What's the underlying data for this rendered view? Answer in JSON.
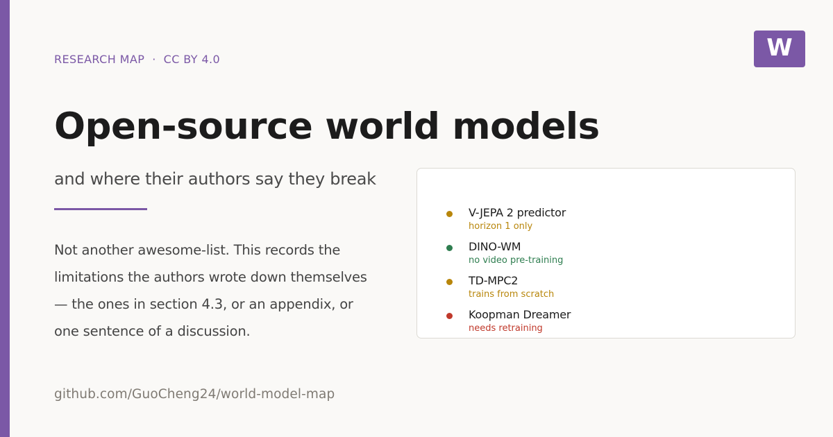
{
  "header": {
    "eyebrow": "RESEARCH MAP  ·  CC BY 4.0",
    "logo_letter": "W"
  },
  "hero": {
    "title": "Open-source world models",
    "subtitle": "and where their authors say they break",
    "description": "Not another awesome-list. This records the limitations the authors wrote down themselves — the ones in section 4.3, or an appendix, or one sentence of a discussion."
  },
  "footer": {
    "repo": "github.com/GuoCheng24/world-model-map"
  },
  "colors": {
    "brand": "#7b58a6",
    "warning": "#b8860b",
    "ok": "#2e7d4f",
    "error": "#c0392b"
  },
  "models": [
    {
      "name": "V-JEPA 2 predictor",
      "note": "horizon 1 only",
      "status": "warning",
      "color": "#b8860b"
    },
    {
      "name": "DINO-WM",
      "note": "no video pre-training",
      "status": "ok",
      "color": "#2e7d4f"
    },
    {
      "name": "TD-MPC2",
      "note": "trains from scratch",
      "status": "warning",
      "color": "#b8860b"
    },
    {
      "name": "Koopman Dreamer",
      "note": "needs retraining",
      "status": "error",
      "color": "#c0392b"
    }
  ]
}
